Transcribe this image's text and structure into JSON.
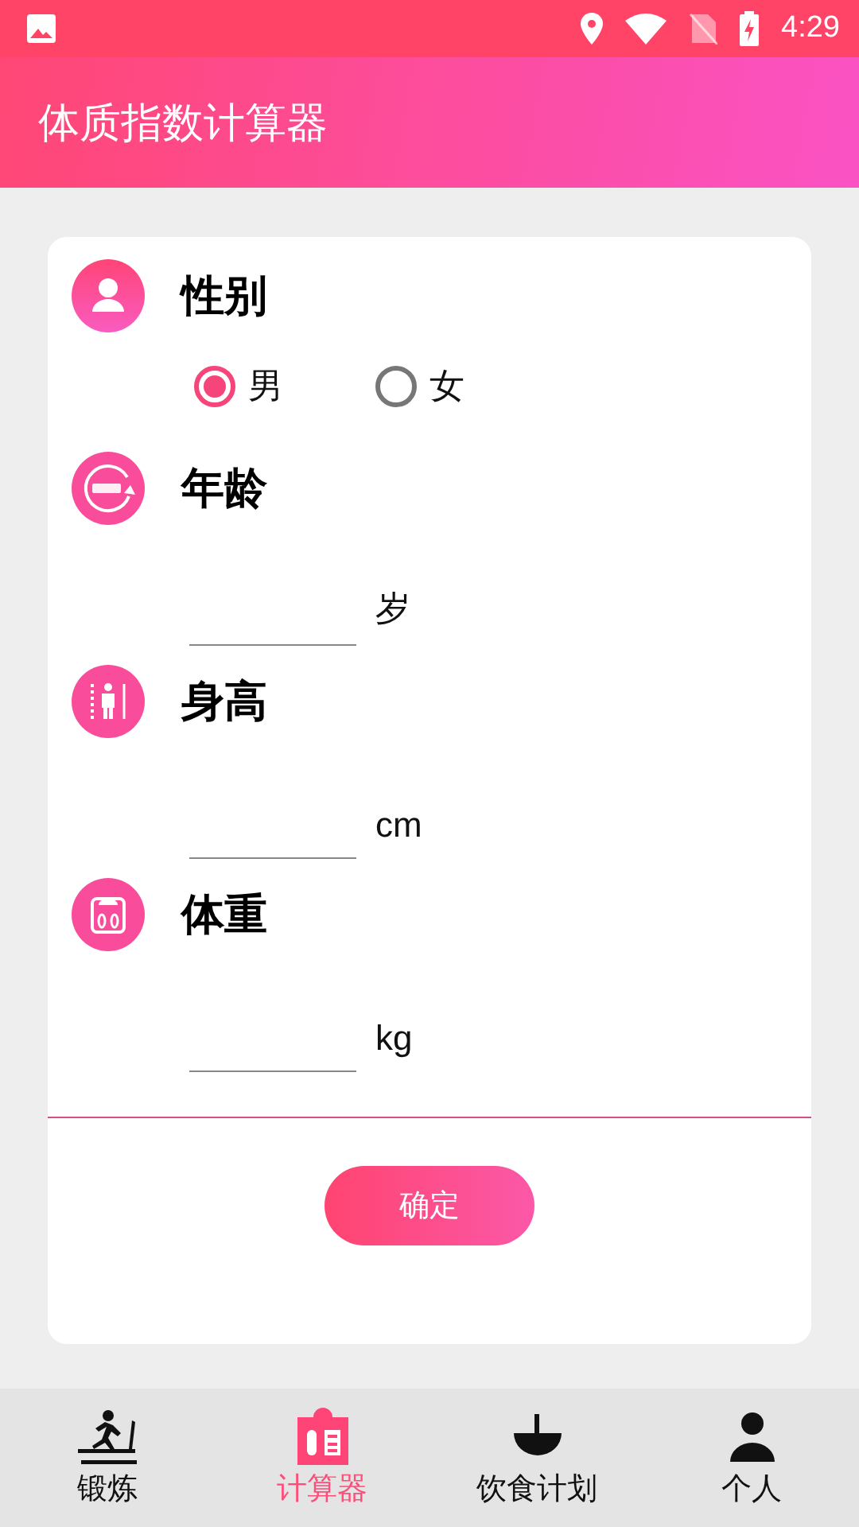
{
  "status_bar": {
    "time": "4:29"
  },
  "app_bar": {
    "title": "体质指数计算器"
  },
  "gender": {
    "label": "性别",
    "options": [
      {
        "label": "男",
        "selected": true
      },
      {
        "label": "女",
        "selected": false
      }
    ]
  },
  "fields": [
    {
      "kind": "age",
      "label": "年龄",
      "unit": "岁"
    },
    {
      "kind": "height",
      "label": "身高",
      "unit": "cm"
    },
    {
      "kind": "weight",
      "label": "体重",
      "unit": "kg"
    }
  ],
  "confirm_button": "确定",
  "nav": [
    {
      "kind": "exercise",
      "label": "锻炼",
      "selected": false
    },
    {
      "kind": "calculator",
      "label": "计算器",
      "selected": true
    },
    {
      "kind": "diet",
      "label": "饮食计划",
      "selected": false
    },
    {
      "kind": "person",
      "label": "个人",
      "selected": false
    }
  ]
}
